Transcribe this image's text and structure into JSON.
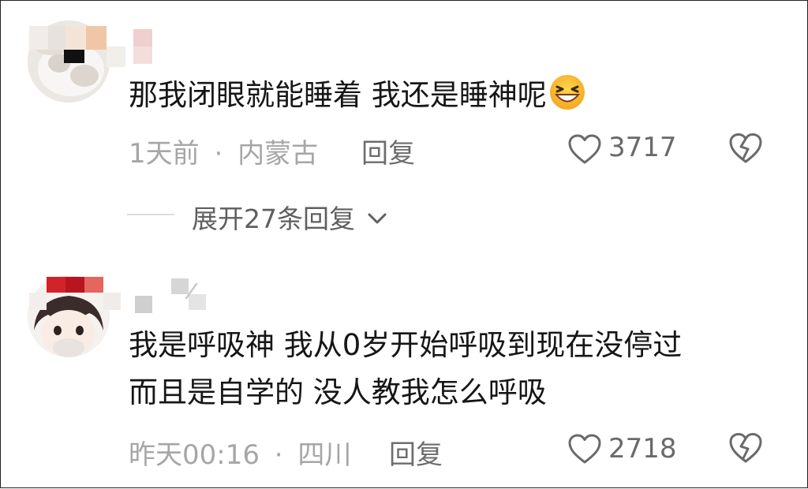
{
  "comments": [
    {
      "text_lines": [
        "那我闭眼就能睡着 我还是睡神呢"
      ],
      "emoji": "grinning-squinting-face",
      "time": "1天前",
      "sep": "·",
      "location": "内蒙古",
      "reply_label": "回复",
      "likes": "3717",
      "expand_label": "展开27条回复"
    },
    {
      "text_lines": [
        "我是呼吸神 我从0岁开始呼吸到现在没停过",
        "而且是自学的 没人教我怎么呼吸"
      ],
      "time": "昨天00:16",
      "sep": "·",
      "location": "四川",
      "reply_label": "回复",
      "likes": "2718"
    }
  ],
  "icons": {
    "like": "heart-outline-icon",
    "dislike": "broken-heart-icon",
    "expand": "chevron-down-icon"
  },
  "colors": {
    "text": "#161616",
    "meta": "#a6a6a6",
    "action": "#6d6d6d",
    "background": "#ffffff"
  }
}
